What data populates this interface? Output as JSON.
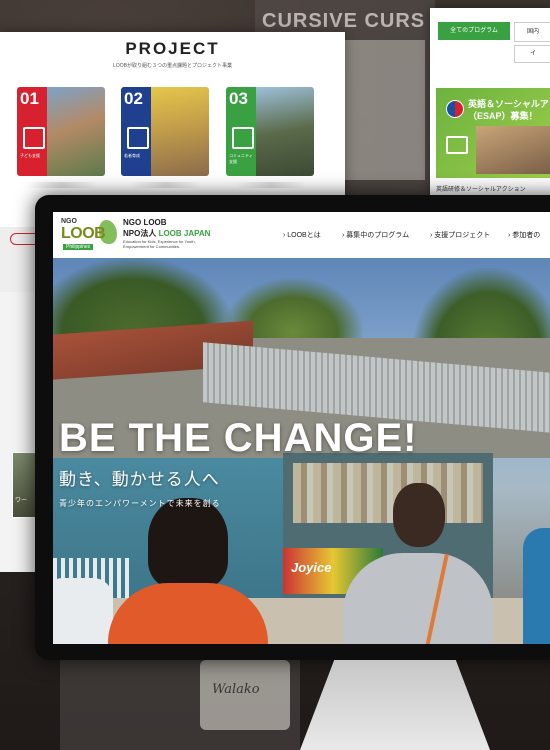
{
  "background": {
    "board_text": "CURSIVE CURS",
    "sign_text": "Walako"
  },
  "project_site": {
    "title": "PROJECT",
    "subtitle": "LOOBが取り組む３つの重点課題とプロジェクト事業",
    "cards": [
      {
        "num": "01",
        "label": "子ども支援",
        "color": "#d7212f"
      },
      {
        "num": "02",
        "label": "若者育成",
        "color": "#1f3f8f"
      },
      {
        "num": "03",
        "label": "コミュニティ支援",
        "color": "#3aa143"
      }
    ],
    "side_thumb_label": "ワー"
  },
  "program_site": {
    "tab_all": "全てのプログラム",
    "tab_domestic": "国内",
    "tab_other": "イ",
    "esap_title_line1": "英語＆ソーシャルア",
    "esap_title_line2": "（ESAP）募集！",
    "footer_text": "英語研修＆ソーシャルアクション"
  },
  "main_site": {
    "logo": {
      "ngo": "NGO",
      "loob": "LOOB",
      "country": "Philippines"
    },
    "org_line1": "NGO LOOB",
    "org_line2_black": "NPO法人 ",
    "org_line2_green": "LOOB JAPAN",
    "tagline": "Education for Kids, Experience for Youth, Empowerment for Communities.",
    "nav": [
      {
        "label": "› LOOBとは"
      },
      {
        "label": "› 募集中のプログラム"
      },
      {
        "label": "› 支援プロジェクト"
      },
      {
        "label": "› 参加者の"
      }
    ],
    "hero": {
      "headline": "BE THE CHANGE!",
      "subheadline": "動き、動かせる人へ",
      "caption": "青少年のエンパワーメントで未来を創る",
      "poster_text": "Joyice"
    }
  },
  "colors": {
    "green": "#3aa143",
    "red": "#d7212f",
    "navy": "#1f3f8f",
    "olive": "#7a8a1a"
  }
}
